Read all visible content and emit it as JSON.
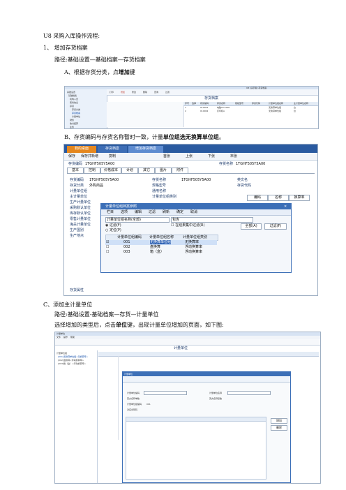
{
  "doc": {
    "title": "U8 采购入库操作流程:",
    "step1": "1、 增加存货档案",
    "path1": "路径:基础设置—基础档案—存货档案",
    "stepA_text": "A、根据存货分类，点",
    "stepA_bold": "增加",
    "stepA_end": "键",
    "stepB_text": "B、存货编码与存货名称暂时一致，计量",
    "stepB_bold": "单位组选无换算单位组",
    "stepB_end": "。",
    "stepC": "C、添加主计量单位",
    "pathC": "路径:基础设置-基础档案—存货—计量单位",
    "selectC_text": "选择增加的类型后，点击",
    "selectC_bold": "单位",
    "selectC_end": "键，出现计量单位增加的页面，如下图:"
  },
  "shot1": {
    "window_caption": "U8 [演示版] 存货档案",
    "toolbar": [
      "打印",
      "增加",
      "修改",
      "删除",
      "查询",
      "过滤"
    ],
    "tree_items": [
      "基础设置",
      "基础档案",
      "机构人员",
      "客商信息",
      "存货",
      "存货分类",
      "存货档案",
      "计量单位",
      "财务",
      "收付结算",
      "业务"
    ],
    "content_title": "存货档案",
    "col_headers": [
      "序号",
      "选择",
      "存货编码",
      "存货名称",
      "规格型号",
      "存货代码",
      "计量单位组名称",
      "主计量单位名称"
    ],
    "rows": [
      [
        "1",
        "",
        "010001",
        "电脑TP-4000",
        "",
        "",
        "无换算单位组",
        "台"
      ],
      [
        "2",
        "",
        "010002",
        "打印机A",
        "",
        "",
        "无换算单位组",
        "台"
      ]
    ]
  },
  "shot2": {
    "tabs": [
      "我的桌面",
      "存货档案",
      "增加存货档案"
    ],
    "toolbar": [
      "保存",
      "保存并新增",
      "复制",
      "首张",
      "上张",
      "下张",
      "末张"
    ],
    "code_label": "存货编码",
    "code_value": "1TGHF505Y5A00",
    "name_label": "存货名称",
    "name_value": "1TGHF505Y5A00",
    "subtabs": [
      "基本",
      "控制",
      "价格成本",
      "计划",
      "其它",
      "图片",
      "附件"
    ],
    "left_labels": [
      "存货编码",
      "存货分类",
      "计量单位组",
      "主计量单位",
      "生产计量单位",
      "采购默认单位",
      "库存默认单位",
      "零售计量单位",
      "海关计量单位",
      "生产国别",
      "生产地点"
    ],
    "cat_value": "外购商品",
    "mid_labels": [
      "存货名称",
      "规格型号",
      "通用名称",
      "计量单位组类别"
    ],
    "right_labels": [
      "英文名",
      "存货代码"
    ],
    "right_btns": [
      "编码",
      "名称",
      "换算率"
    ],
    "dialog": {
      "title": "计量单位组档案参照",
      "toolbar": [
        "栏目",
        "选项",
        "编辑",
        "过滤",
        "刷新",
        "确定",
        "取消"
      ],
      "filter_value": "计量单位组名称(全部)",
      "filter_op": "包含",
      "radio1": "过滤(F)",
      "radio2": "定位(P)",
      "check": "在结果集中过滤(R)",
      "btn_all": "全部(A)",
      "btn_filter": "过滤(F)",
      "headers": [
        "计量单位组编码",
        "计量单位组名称",
        "计量单位组类别"
      ],
      "rows": [
        [
          "001",
          "无换算单位组",
          "无换算率"
        ],
        [
          "002",
          "盘换算",
          "浮动换算率"
        ],
        [
          "003",
          "箱（盒）",
          "浮动换算率"
        ]
      ]
    },
    "bottom_label": "存货属性"
  },
  "shot3": {
    "window_caption": "计量单位",
    "menu": [
      "文件",
      "操作",
      "帮助"
    ],
    "tree": [
      "计量单位组",
      "(001)无换算单位组<无换算率>",
      "(002)盘换算<浮动换算率>",
      "(003)箱（盒）<浮动换算率>"
    ],
    "main_title": "计量单位",
    "dialog_title": "计量单位",
    "dialog_fields": [
      "计量单位编码",
      "计量单位名称",
      "英文名称单数",
      "英文名称复数",
      "计量单位组编码",
      "对应条形码"
    ],
    "dialog_group_value": "001",
    "btn_add": "增加",
    "btn_delete": "删除"
  }
}
